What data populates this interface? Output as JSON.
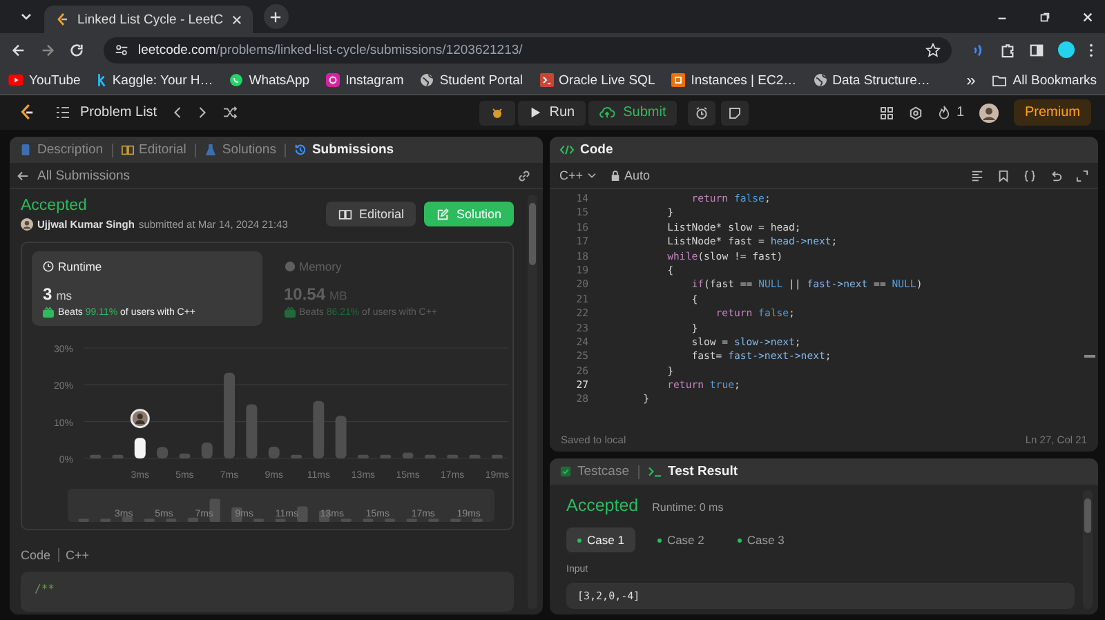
{
  "browser": {
    "tab_title": "Linked List Cycle - LeetC",
    "url_host": "leetcode.com",
    "url_path": "/problems/linked-list-cycle/submissions/1203621213/",
    "bookmarks": [
      {
        "label": "YouTube",
        "kind": "youtube"
      },
      {
        "label": "Kaggle: Your H…",
        "kind": "kaggle"
      },
      {
        "label": "WhatsApp",
        "kind": "whatsapp"
      },
      {
        "label": "Instagram",
        "kind": "instagram"
      },
      {
        "label": "Student Portal",
        "kind": "globe"
      },
      {
        "label": "Oracle Live SQL",
        "kind": "oracle"
      },
      {
        "label": "Instances | EC2…",
        "kind": "aws"
      },
      {
        "label": "Data Structure…",
        "kind": "globe"
      }
    ],
    "overflow": "»",
    "all_bookmarks": "All Bookmarks"
  },
  "navbar": {
    "problem_list": "Problem List",
    "run": "Run",
    "submit": "Submit",
    "streak": "1",
    "premium": "Premium"
  },
  "left_tabs": [
    {
      "label": "Description",
      "kind": "description",
      "selected": false
    },
    {
      "label": "Editorial",
      "kind": "editorial",
      "selected": false
    },
    {
      "label": "Solutions",
      "kind": "solutions",
      "selected": false
    },
    {
      "label": "Submissions",
      "kind": "submissions",
      "selected": true
    }
  ],
  "all_submissions": "All Submissions",
  "submission": {
    "status": "Accepted",
    "user": "Ujjwal Kumar Singh",
    "submitted": "submitted at Mar 14, 2024 21:43",
    "editorial": "Editorial",
    "solution": "Solution"
  },
  "stats": [
    {
      "kind": "runtime",
      "label": "Runtime",
      "value": "3",
      "unit": "ms",
      "beats": "Beats",
      "percent": "99.11%",
      "suffix": "of users with C++",
      "selected": true
    },
    {
      "kind": "memory",
      "label": "Memory",
      "value": "10.54",
      "unit": "MB",
      "beats": "Beats",
      "percent": "86.21%",
      "suffix": "of users with C++",
      "selected": false
    }
  ],
  "distribution": {
    "chart_data": {
      "type": "bar",
      "x": [
        1,
        2,
        3,
        4,
        5,
        6,
        7,
        8,
        9,
        10,
        11,
        12,
        13,
        14,
        15,
        16,
        17,
        18,
        19
      ],
      "xlim": [
        0.5,
        19.5
      ],
      "stacked": true,
      "series": [
        {
          "color": "#4f4f4f",
          "values": [
            1,
            1,
            null,
            3.1,
            1.3,
            4.3,
            23.3,
            14.7,
            3.2,
            1,
            15.6,
            11.6,
            1,
            1,
            1.6,
            1,
            1,
            1,
            1
          ]
        },
        {
          "color": "#f5f5f5",
          "values": [
            null,
            null,
            5.6,
            null,
            null,
            null,
            null,
            null,
            null,
            null,
            null,
            null,
            null,
            null,
            null,
            null,
            null,
            null,
            null
          ]
        }
      ],
      "ylim": [
        0,
        30
      ],
      "yticks": [
        {
          "value": 0,
          "label": "0%"
        },
        {
          "value": 10,
          "label": "10%"
        },
        {
          "value": 20,
          "label": "20%"
        },
        {
          "value": 30,
          "label": "30%"
        }
      ],
      "xticks": [
        {
          "value": 3,
          "label": "3ms"
        },
        {
          "value": 5,
          "label": "5ms"
        },
        {
          "value": 7,
          "label": "7ms"
        },
        {
          "value": 9,
          "label": "9ms"
        },
        {
          "value": 11,
          "label": "11ms"
        },
        {
          "value": 13,
          "label": "13ms"
        },
        {
          "value": 15,
          "label": "15ms"
        },
        {
          "value": 17,
          "label": "17ms"
        },
        {
          "value": 19,
          "label": "19ms"
        }
      ]
    },
    "overview_labels": [
      "3ms",
      "5ms",
      "7ms",
      "9ms",
      "11ms",
      "13ms",
      "15ms",
      "17ms",
      "19ms"
    ]
  },
  "code_label": "Code",
  "code_lang": "C++",
  "code_preview": "/**",
  "editor": {
    "title": "Code",
    "language": "C++",
    "mode": "Auto",
    "lines": [
      {
        "n": "14",
        "current": false,
        "tokens": [
          {
            "text": "            return",
            "kind": "keyword"
          },
          {
            "text": " false",
            "kind": "literal"
          },
          {
            "text": ";",
            "kind": "plain"
          }
        ]
      },
      {
        "n": "15",
        "current": false,
        "tokens": [
          {
            "text": "        }",
            "kind": "plain"
          }
        ]
      },
      {
        "n": "16",
        "current": false,
        "tokens": [
          {
            "text": "        ListNode* slow = head;",
            "kind": "plain"
          }
        ]
      },
      {
        "n": "17",
        "current": false,
        "tokens": [
          {
            "text": "        ListNode* fast = ",
            "kind": "plain"
          },
          {
            "text": "head->next",
            "kind": "member"
          },
          {
            "text": ";",
            "kind": "plain"
          }
        ]
      },
      {
        "n": "18",
        "current": false,
        "tokens": [
          {
            "text": "        while",
            "kind": "keyword"
          },
          {
            "text": "(slow != fast)",
            "kind": "plain"
          }
        ]
      },
      {
        "n": "19",
        "current": false,
        "tokens": [
          {
            "text": "        {",
            "kind": "plain"
          }
        ]
      },
      {
        "n": "20",
        "current": false,
        "tokens": [
          {
            "text": "            if",
            "kind": "keyword"
          },
          {
            "text": "(fast == ",
            "kind": "plain"
          },
          {
            "text": "NULL",
            "kind": "literal"
          },
          {
            "text": " || ",
            "kind": "plain"
          },
          {
            "text": "fast->next",
            "kind": "member"
          },
          {
            "text": " == ",
            "kind": "plain"
          },
          {
            "text": "NULL",
            "kind": "literal"
          },
          {
            "text": ")",
            "kind": "plain"
          }
        ]
      },
      {
        "n": "21",
        "current": false,
        "tokens": [
          {
            "text": "            {",
            "kind": "plain"
          }
        ]
      },
      {
        "n": "22",
        "current": false,
        "tokens": [
          {
            "text": "                return",
            "kind": "keyword"
          },
          {
            "text": " false",
            "kind": "literal"
          },
          {
            "text": ";",
            "kind": "plain"
          }
        ]
      },
      {
        "n": "23",
        "current": false,
        "tokens": [
          {
            "text": "            }",
            "kind": "plain"
          }
        ]
      },
      {
        "n": "24",
        "current": false,
        "tokens": [
          {
            "text": "            slow = ",
            "kind": "plain"
          },
          {
            "text": "slow->next",
            "kind": "member"
          },
          {
            "text": ";",
            "kind": "plain"
          }
        ]
      },
      {
        "n": "25",
        "current": false,
        "tokens": [
          {
            "text": "            fast= ",
            "kind": "plain"
          },
          {
            "text": "fast->next->next",
            "kind": "member"
          },
          {
            "text": ";",
            "kind": "plain"
          }
        ]
      },
      {
        "n": "26",
        "current": false,
        "tokens": [
          {
            "text": "        }",
            "kind": "plain"
          }
        ]
      },
      {
        "n": "27",
        "current": true,
        "tokens": [
          {
            "text": "        return",
            "kind": "keyword"
          },
          {
            "text": " true",
            "kind": "literal"
          },
          {
            "text": ";",
            "kind": "plain"
          }
        ]
      },
      {
        "n": "28",
        "current": false,
        "tokens": [
          {
            "text": "    }",
            "kind": "plain"
          }
        ]
      }
    ],
    "saved": "Saved to local",
    "cursor": "Ln 27, Col 21"
  },
  "result": {
    "tabs": [
      {
        "label": "Testcase",
        "kind": "testcase",
        "selected": false
      },
      {
        "label": "Test Result",
        "kind": "result",
        "selected": true
      }
    ],
    "status": "Accepted",
    "runtime": "Runtime: 0 ms",
    "cases": [
      {
        "label": "Case 1",
        "selected": true,
        "color": "#2cbb5d"
      },
      {
        "label": "Case 2",
        "selected": false,
        "color": "#2cbb5d"
      },
      {
        "label": "Case 3",
        "selected": false,
        "color": "#2cbb5d"
      }
    ],
    "input_label": "Input",
    "input": "[3,2,0,-4]"
  }
}
